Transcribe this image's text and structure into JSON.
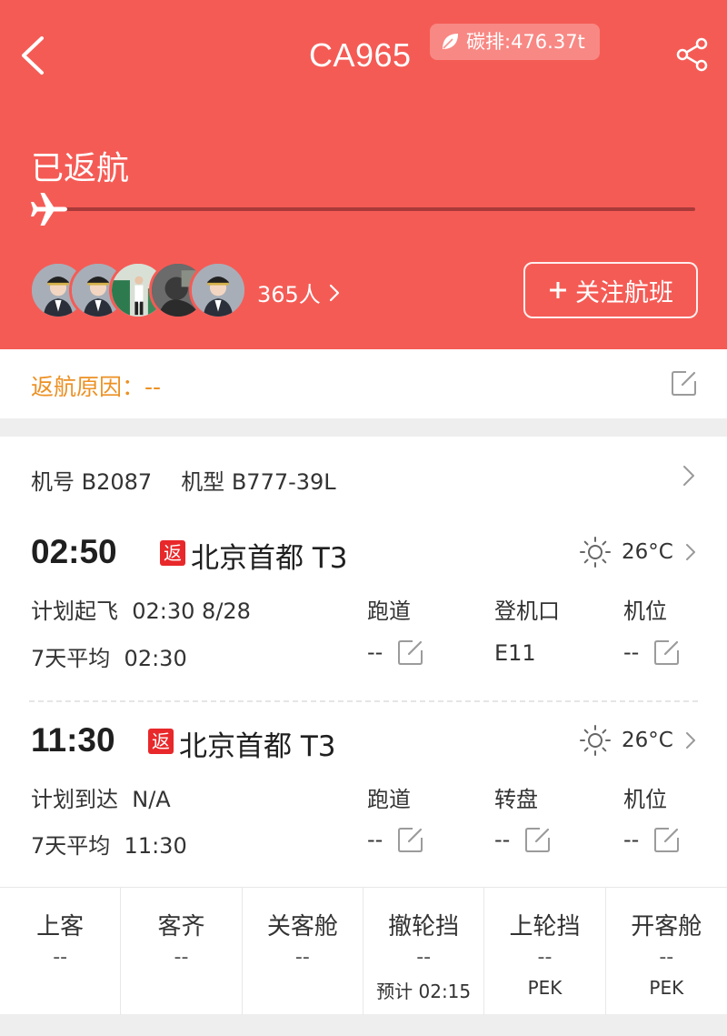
{
  "header": {
    "flight_no": "CA965",
    "carbon": "碳排:476.37t",
    "status": "已返航",
    "fans": "365人",
    "follow": "关注航班",
    "colors": {
      "bg": "#f55b55",
      "track": "#a93a39"
    }
  },
  "reason": {
    "label": "返航原因：",
    "value": "--"
  },
  "aircraft": {
    "reg_label": "机号",
    "reg": "B2087",
    "type_label": "机型",
    "type": "B777-39L"
  },
  "departure": {
    "time": "02:50",
    "badge": "返",
    "airport": "北京首都",
    "terminal": "T3",
    "temp": "26°C",
    "plan_label": "计划起飞",
    "plan_value": "02:30 8/28",
    "avg_label": "7天平均",
    "avg_value": "02:30",
    "col1_label": "跑道",
    "col1_value": "--",
    "col2_label": "登机口",
    "col2_value": "E11",
    "col3_label": "机位",
    "col3_value": "--"
  },
  "arrival": {
    "time": "11:30",
    "badge": "返",
    "airport": "北京首都",
    "terminal": "T3",
    "temp": "26°C",
    "plan_label": "计划到达",
    "plan_value": "N/A",
    "avg_label": "7天平均",
    "avg_value": "11:30",
    "col1_label": "跑道",
    "col1_value": "--",
    "col2_label": "转盘",
    "col2_value": "--",
    "col3_label": "机位",
    "col3_value": "--"
  },
  "ground": [
    {
      "label": "上客",
      "value": "--",
      "sub": ""
    },
    {
      "label": "客齐",
      "value": "--",
      "sub": ""
    },
    {
      "label": "关客舱",
      "value": "--",
      "sub": ""
    },
    {
      "label": "撤轮挡",
      "value": "--",
      "sub": "预计 02:15"
    },
    {
      "label": "上轮挡",
      "value": "--",
      "sub": "PEK"
    },
    {
      "label": "开客舱",
      "value": "--",
      "sub": "PEK"
    }
  ],
  "icons": [
    "back-arrow-icon",
    "leaf-icon",
    "share-icon",
    "airplane-icon",
    "chevron-right-icon",
    "plus-icon",
    "edit-icon",
    "sun-icon"
  ]
}
